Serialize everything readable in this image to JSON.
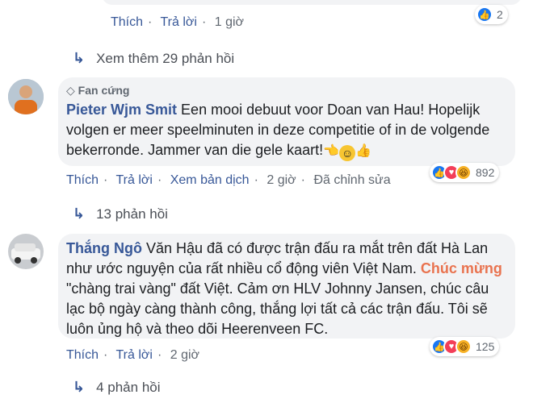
{
  "top_comment": {
    "actions": [
      "Thích",
      "Trả lời",
      "1 giờ"
    ],
    "reaction_count": "2",
    "view_more": "Xem thêm 29 phản hồi"
  },
  "comments": [
    {
      "badge": "Fan cứng",
      "author": "Pieter Wjm Smit",
      "text": "Een mooi debuut voor Doan van Hau! Hopelijk volgen er meer speelminuten in deze competitie of in de volgende bekerronde. Jammer van die gele kaart!",
      "actions": [
        "Thích",
        "Trả lời",
        "Xem bản dịch",
        "2 giờ",
        "Đã chỉnh sửa"
      ],
      "reaction_count": "892",
      "replies": "13 phản hồi"
    },
    {
      "author": "Thắng Ngô",
      "text_part1": "Văn Hậu đã có được trận đấu ra mắt trên đất Hà Lan như ước nguyện của rất nhiều cổ động viên Việt Nam.",
      "mention": "Chúc mừng",
      "text_part2": "\"chàng trai vàng\" đất Việt. Cảm ơn HLV Johnny Jansen, chúc câu lạc bộ ngày càng thành công, thắng lợi tất cả các trận đấu. Tôi sẽ luôn ủng hộ và theo dõi Heerenveen FC.",
      "actions": [
        "Thích",
        "Trả lời",
        "2 giờ"
      ],
      "reaction_count": "125",
      "replies": "4 phản hồi"
    }
  ],
  "colors": {
    "link": "#385898",
    "mention": "#e9734f",
    "bubble": "#f2f3f5",
    "like": "#1877f2"
  }
}
